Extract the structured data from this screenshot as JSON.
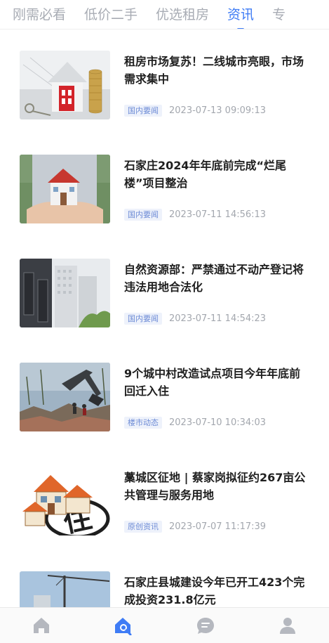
{
  "tabs": [
    {
      "label": "刚需必看",
      "active": false
    },
    {
      "label": "低价二手",
      "active": false
    },
    {
      "label": "优选租房",
      "active": false
    },
    {
      "label": "资讯",
      "active": true
    },
    {
      "label": "专",
      "active": false
    }
  ],
  "articles": [
    {
      "title": "租房市场复苏！二线城市亮眼，市场需求集中",
      "tag": "国内要闻",
      "time": "2023-07-13 09:09:13"
    },
    {
      "title": "石家庄2024年年底前完成“烂尾楼”项目整治",
      "tag": "国内要闻",
      "time": "2023-07-11 14:56:13"
    },
    {
      "title": "自然资源部：严禁通过不动产登记将违法用地合法化",
      "tag": "国内要闻",
      "time": "2023-07-11 14:54:23"
    },
    {
      "title": "9个城中村改造试点项目今年年底前回迁入住",
      "tag": "楼市动态",
      "time": "2023-07-10 10:34:03"
    },
    {
      "title": "藁城区征地 | 蔡家岗拟征约267亩公共管理与服务用地",
      "tag": "原创资讯",
      "time": "2023-07-07 11:17:39"
    },
    {
      "title": "石家庄县城建设今年已开工423个完成投资231.8亿元",
      "tag": "",
      "time": ""
    }
  ],
  "image_marks": {
    "item5": "住"
  },
  "colors": {
    "accent": "#3f7cf5",
    "tab_inactive": "#a8acb4",
    "tag_text": "#6d8bd6",
    "nav_inactive": "#b5b8bf"
  },
  "bottom_nav": [
    {
      "icon": "home-icon",
      "active": false
    },
    {
      "icon": "house-search-icon",
      "active": true
    },
    {
      "icon": "chat-icon",
      "active": false
    },
    {
      "icon": "user-icon",
      "active": false
    }
  ]
}
